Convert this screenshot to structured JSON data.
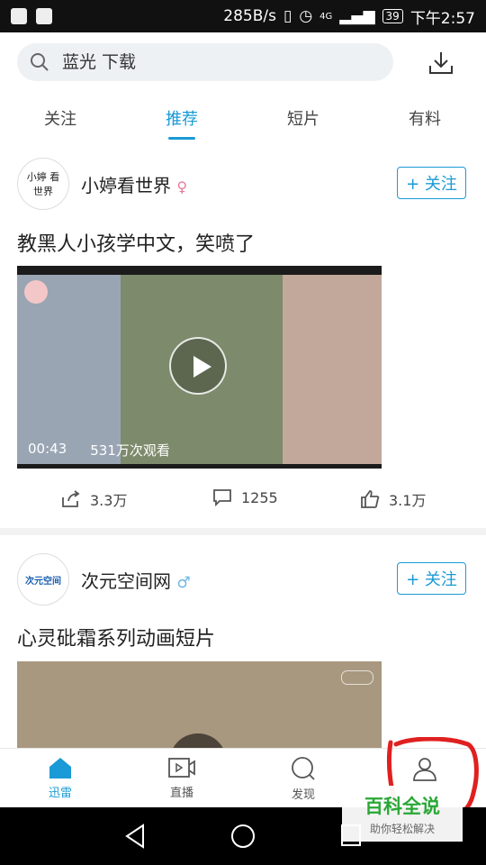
{
  "status_bar": {
    "speed": "285B/s",
    "network": "4G",
    "battery": "39",
    "time": "下午2:57"
  },
  "search": {
    "placeholder": "蓝光 下载"
  },
  "tabs": [
    {
      "label": "关注"
    },
    {
      "label": "推荐",
      "active": true
    },
    {
      "label": "短片"
    },
    {
      "label": "有料"
    }
  ],
  "posts": [
    {
      "author": "小婷看世界",
      "avatar_text": "小婷 看世界",
      "follow_label": "+ 关注",
      "title": "教黑人小孩学中文，笑喷了",
      "duration": "00:43",
      "views": "531万次观看",
      "shares": "3.3万",
      "comments": "1255",
      "likes": "3.1万"
    },
    {
      "author": "次元空间网",
      "avatar_text": "次元空间",
      "follow_label": "+ 关注",
      "title": "心灵砒霜系列动画短片"
    }
  ],
  "bottom_nav": [
    {
      "label": "迅雷",
      "icon": "home-icon",
      "active": true
    },
    {
      "label": "直播",
      "icon": "live-video-icon"
    },
    {
      "label": "发现",
      "icon": "discover-search-icon"
    },
    {
      "label": "",
      "icon": "profile-icon"
    }
  ],
  "watermark": {
    "title": "百科全说",
    "subtitle": "助你轻松解决"
  },
  "colors": {
    "accent": "#1a9ad6",
    "watermark_green": "#2aa836",
    "annotation_red": "#e02020"
  }
}
